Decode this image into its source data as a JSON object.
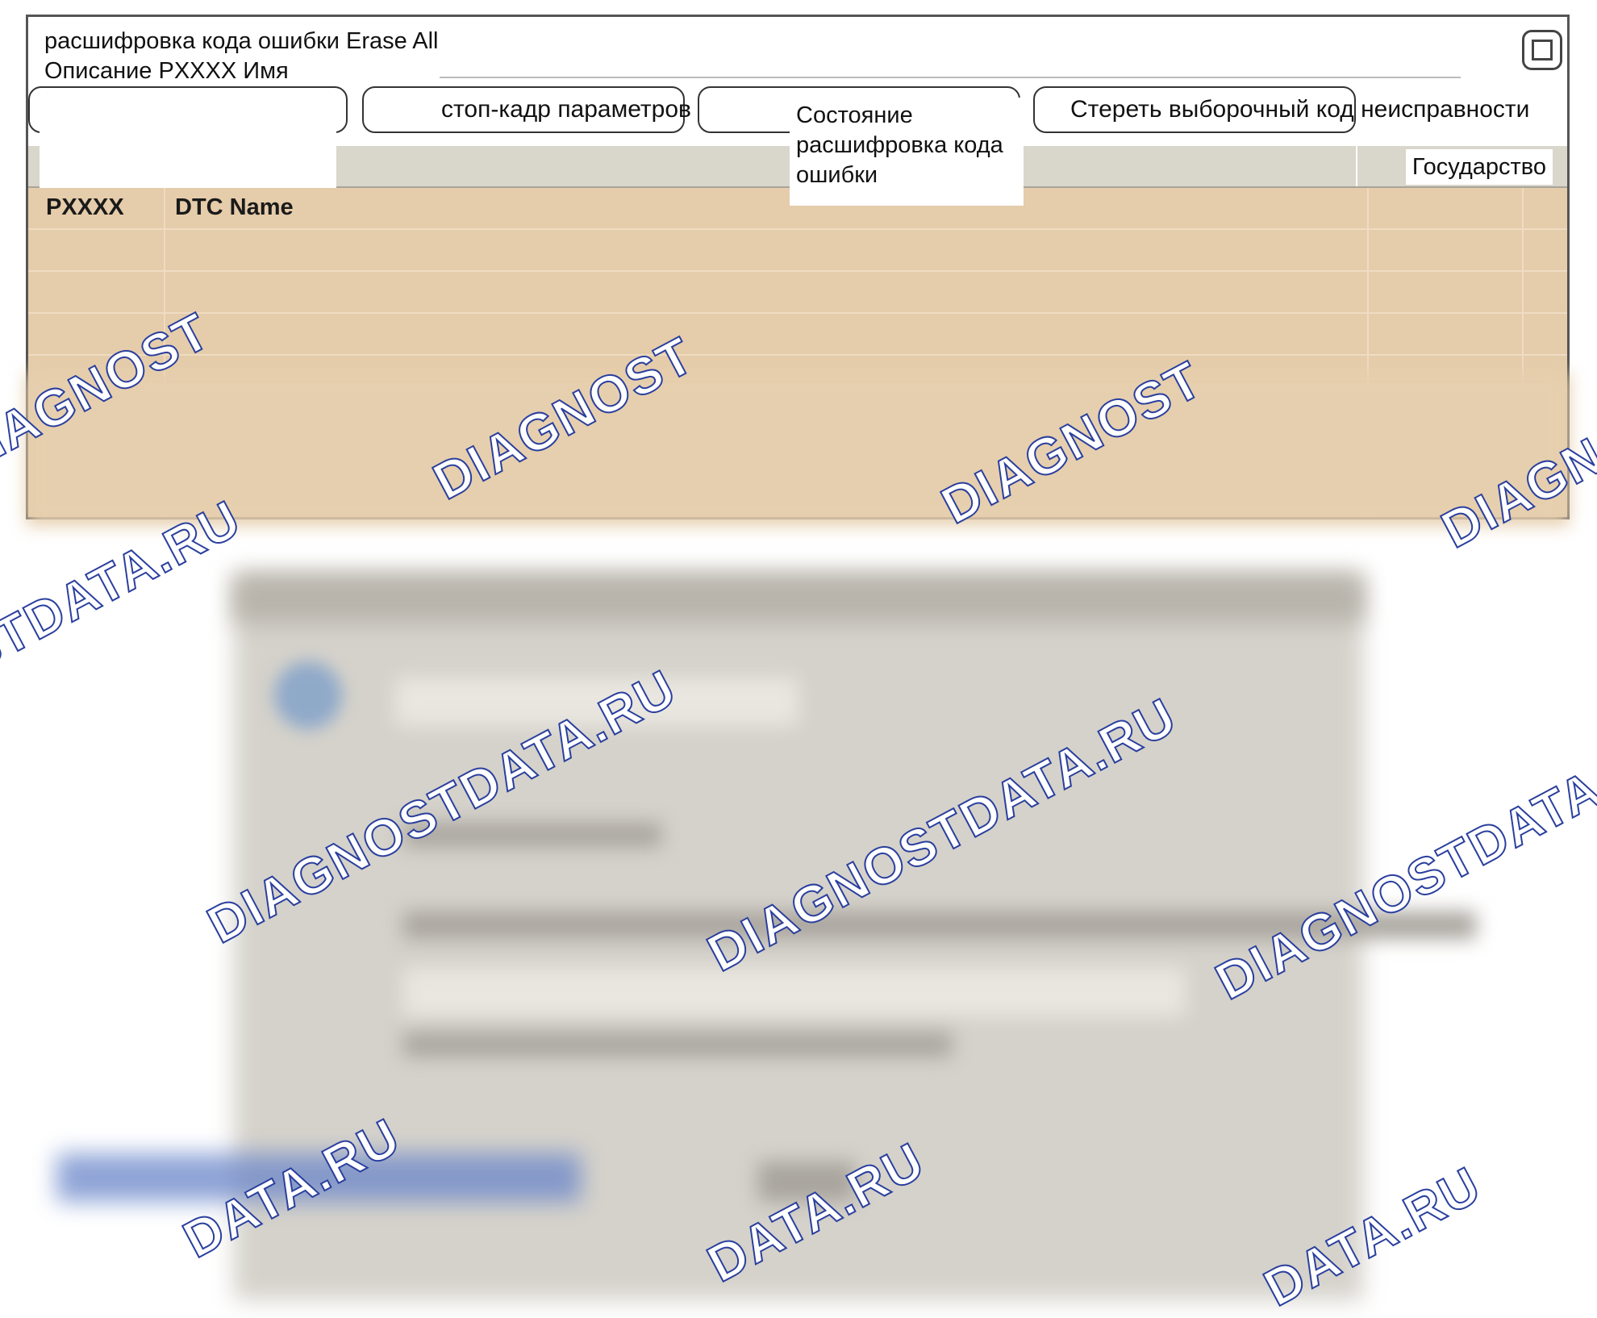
{
  "window": {
    "title": "расшифровка кода ошибки Erase All Описание PXXXX Имя",
    "maximize_icon": "maximize-icon"
  },
  "tabs": [
    {
      "label": ""
    },
    {
      "label": "стоп-кадр параметров"
    },
    {
      "label": ""
    },
    {
      "label": "Стереть выборочный код неисправности"
    }
  ],
  "state_popup": "Состояние расшифровка кода ошибки",
  "grid": {
    "state_column": "Государство",
    "columns": [
      "PXXXX",
      "DTC Name"
    ]
  },
  "watermark": {
    "text_long": "DIAGNOSTDATA.RU",
    "text_short": "DIAGNOST",
    "text_end": "DATA.RU",
    "color": "#2a3f9e"
  }
}
